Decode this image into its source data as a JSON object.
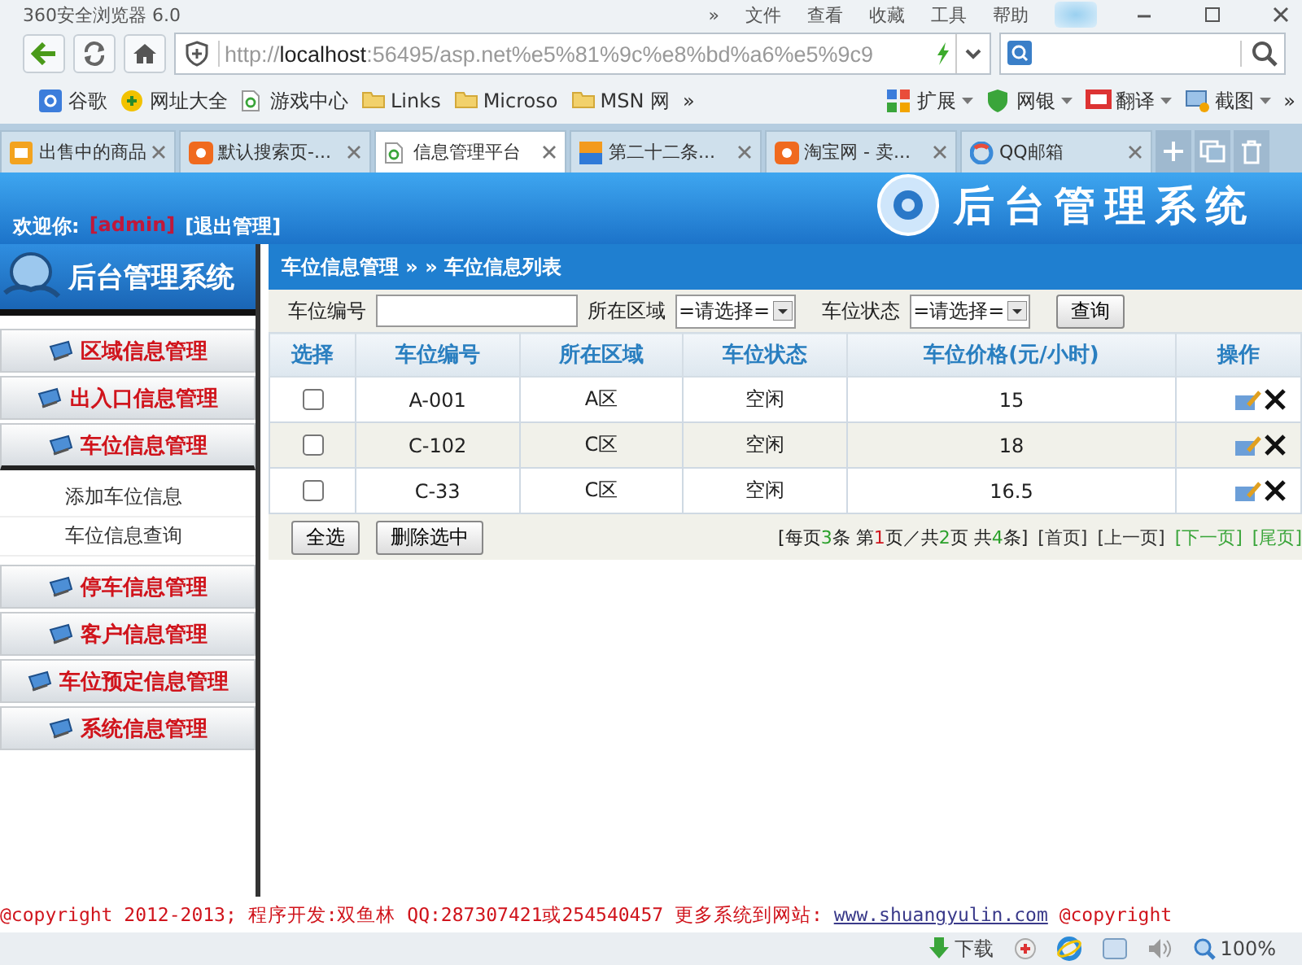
{
  "browser": {
    "title": "360安全浏览器 6.0",
    "menu": [
      "»",
      "文件",
      "查看",
      "收藏",
      "工具",
      "帮助"
    ],
    "url": {
      "scheme": "http://",
      "host": "localhost",
      "rest": ":56495/asp.net%e5%81%9c%e8%bd%a6%e5%9c9"
    },
    "bookmarks": [
      {
        "label": "谷歌",
        "kind": "google"
      },
      {
        "label": "网址大全",
        "kind": "sites"
      },
      {
        "label": "游戏中心",
        "kind": "page"
      },
      {
        "label": "Links",
        "kind": "folder"
      },
      {
        "label": "Microso",
        "kind": "folder"
      },
      {
        "label": "MSN 网",
        "kind": "folder"
      }
    ],
    "bookmarks_more": "»",
    "extensions": [
      {
        "label": "扩展",
        "kind": "grid"
      },
      {
        "label": "网银",
        "kind": "shield"
      },
      {
        "label": "翻译",
        "kind": "translate"
      },
      {
        "label": "截图",
        "kind": "screenshot"
      }
    ],
    "extensions_more": "»",
    "tabs": [
      {
        "label": "出售中的商品",
        "selected": false,
        "kind": "shop"
      },
      {
        "label": "默认搜索页-...",
        "selected": false,
        "kind": "taobao"
      },
      {
        "label": "信息管理平台",
        "selected": true,
        "kind": "page"
      },
      {
        "label": "第二十二条...",
        "selected": false,
        "kind": "soku"
      },
      {
        "label": "淘宝网 - 卖...",
        "selected": false,
        "kind": "taobao"
      },
      {
        "label": "QQ邮箱",
        "selected": false,
        "kind": "qq"
      }
    ],
    "status": {
      "download": "下载",
      "zoom": "100%"
    }
  },
  "page": {
    "welcome": "欢迎你:",
    "user": "[admin]",
    "logout": "[退出管理]",
    "banner_title": "后台管理系统",
    "sidebar_title": "后台管理系统",
    "menu": [
      {
        "label": "区域信息管理",
        "expanded": false
      },
      {
        "label": "出入口信息管理",
        "expanded": false
      },
      {
        "label": "车位信息管理",
        "expanded": true,
        "children": [
          {
            "label": "添加车位信息"
          },
          {
            "label": "车位信息查询"
          }
        ]
      },
      {
        "label": "停车信息管理",
        "expanded": false
      },
      {
        "label": "客户信息管理",
        "expanded": false
      },
      {
        "label": "车位预定信息管理",
        "expanded": false
      },
      {
        "label": "系统信息管理",
        "expanded": false
      }
    ],
    "breadcrumb": "车位信息管理 » » 车位信息列表",
    "search": {
      "number_label": "车位编号",
      "area_label": "所在区域",
      "area_value": "=请选择=",
      "status_label": "车位状态",
      "status_value": "=请选择=",
      "button": "查询"
    },
    "table": {
      "columns": [
        "选择",
        "车位编号",
        "所在区域",
        "车位状态",
        "车位价格(元/小时)",
        "操作"
      ],
      "rows": [
        {
          "checked": false,
          "cells": [
            "",
            "A-001",
            "A区",
            "空闲",
            "15"
          ]
        },
        {
          "checked": false,
          "cells": [
            "",
            "C-102",
            "C区",
            "空闲",
            "18"
          ]
        },
        {
          "checked": false,
          "cells": [
            "",
            "C-33",
            "C区",
            "空闲",
            "16.5"
          ]
        }
      ]
    },
    "select_all": "全选",
    "delete_selected": "删除选中",
    "pager": {
      "summary": [
        {
          "text": "[每页",
          "highlight": false
        },
        {
          "text": "3",
          "highlight": true
        },
        {
          "text": "条 第",
          "highlight": false
        },
        {
          "text": "1",
          "highlight": true
        },
        {
          "text": "页／共",
          "highlight": false
        },
        {
          "text": "2",
          "highlight": true
        },
        {
          "text": "页 共",
          "highlight": false
        },
        {
          "text": "4",
          "highlight": true
        },
        {
          "text": "条]",
          "highlight": false
        }
      ],
      "links": [
        {
          "label": "[首页]",
          "enabled": false
        },
        {
          "label": "[上一页]",
          "enabled": false
        },
        {
          "label": "[下一页]",
          "enabled": true
        },
        {
          "label": "[尾页]",
          "enabled": true
        }
      ]
    },
    "footer": {
      "before": "@copyright 2012-2013; 程序开发:双鱼林  QQ:287307421或254540457  更多系统到网站: ",
      "link": "www.shuangyulin.com",
      "after": " @copyright"
    }
  }
}
